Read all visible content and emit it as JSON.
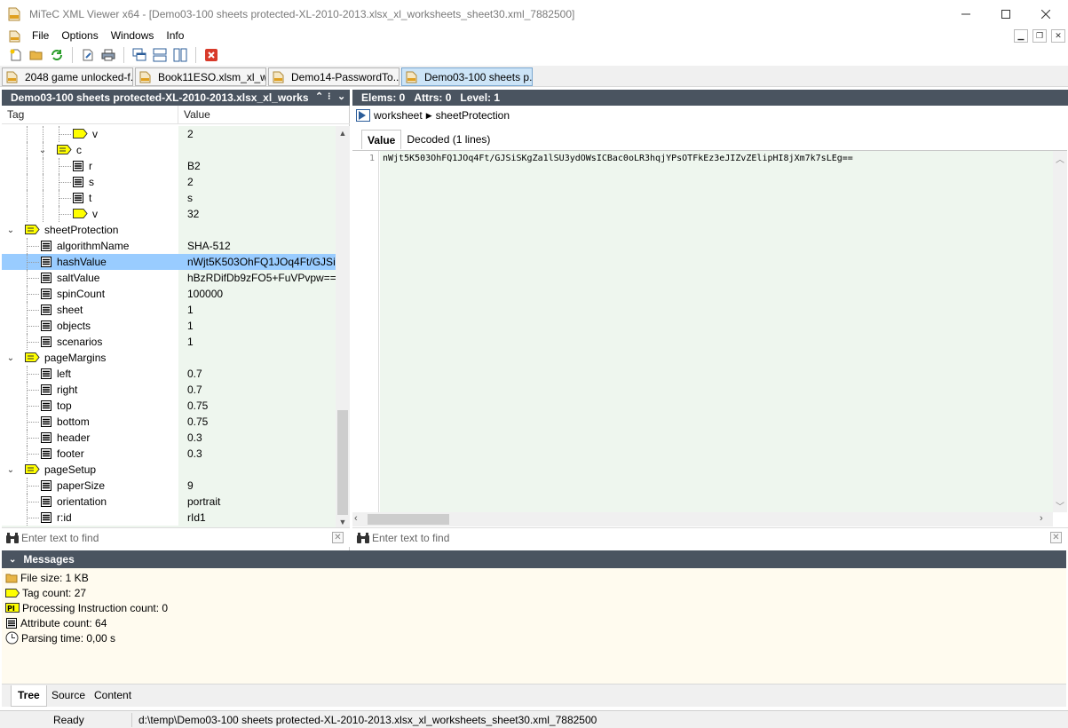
{
  "window": {
    "title": "MiTeC XML Viewer x64 - [Demo03-100 sheets protected-XL-2010-2013.xlsx_xl_worksheets_sheet30.xml_7882500]"
  },
  "menu": [
    "File",
    "Options",
    "Windows",
    "Info"
  ],
  "doc_tabs": [
    {
      "label": "2048 game unlocked-f...",
      "active": false
    },
    {
      "label": "Book11ESO.xlsm_xl_w...",
      "active": false
    },
    {
      "label": "Demo14-PasswordTo...",
      "active": false
    },
    {
      "label": "Demo03-100 sheets p...",
      "active": true
    }
  ],
  "left_panel": {
    "title": "Demo03-100 sheets protected-XL-2010-2013.xlsx_xl_works",
    "col_tag": "Tag",
    "col_value": "Value",
    "find_placeholder": "Enter text to find"
  },
  "tree": [
    {
      "label": "v",
      "value": "2",
      "kind": "element",
      "level": 4,
      "expander": ""
    },
    {
      "label": "c",
      "value": "",
      "kind": "element",
      "level": 3,
      "expander": "open"
    },
    {
      "label": "r",
      "value": "B2",
      "kind": "attr",
      "level": 4,
      "expander": ""
    },
    {
      "label": "s",
      "value": "2",
      "kind": "attr",
      "level": 4,
      "expander": ""
    },
    {
      "label": "t",
      "value": "s",
      "kind": "attr",
      "level": 4,
      "expander": ""
    },
    {
      "label": "v",
      "value": "32",
      "kind": "element",
      "level": 4,
      "expander": ""
    },
    {
      "label": "sheetProtection",
      "value": "",
      "kind": "element",
      "level": 1,
      "expander": "open"
    },
    {
      "label": "algorithmName",
      "value": "SHA-512",
      "kind": "attr",
      "level": 2,
      "expander": ""
    },
    {
      "label": "hashValue",
      "value": "nWjt5K503OhFQ1JOq4Ft/GJSi...",
      "kind": "attr",
      "level": 2,
      "expander": "",
      "selected": true
    },
    {
      "label": "saltValue",
      "value": "hBzRDifDb9zFO5+FuVPvpw==",
      "kind": "attr",
      "level": 2,
      "expander": ""
    },
    {
      "label": "spinCount",
      "value": "100000",
      "kind": "attr",
      "level": 2,
      "expander": ""
    },
    {
      "label": "sheet",
      "value": "1",
      "kind": "attr",
      "level": 2,
      "expander": ""
    },
    {
      "label": "objects",
      "value": "1",
      "kind": "attr",
      "level": 2,
      "expander": ""
    },
    {
      "label": "scenarios",
      "value": "1",
      "kind": "attr",
      "level": 2,
      "expander": ""
    },
    {
      "label": "pageMargins",
      "value": "",
      "kind": "element",
      "level": 1,
      "expander": "open"
    },
    {
      "label": "left",
      "value": "0.7",
      "kind": "attr",
      "level": 2,
      "expander": ""
    },
    {
      "label": "right",
      "value": "0.7",
      "kind": "attr",
      "level": 2,
      "expander": ""
    },
    {
      "label": "top",
      "value": "0.75",
      "kind": "attr",
      "level": 2,
      "expander": ""
    },
    {
      "label": "bottom",
      "value": "0.75",
      "kind": "attr",
      "level": 2,
      "expander": ""
    },
    {
      "label": "header",
      "value": "0.3",
      "kind": "attr",
      "level": 2,
      "expander": ""
    },
    {
      "label": "footer",
      "value": "0.3",
      "kind": "attr",
      "level": 2,
      "expander": ""
    },
    {
      "label": "pageSetup",
      "value": "",
      "kind": "element",
      "level": 1,
      "expander": "open"
    },
    {
      "label": "paperSize",
      "value": "9",
      "kind": "attr",
      "level": 2,
      "expander": ""
    },
    {
      "label": "orientation",
      "value": "portrait",
      "kind": "attr",
      "level": 2,
      "expander": ""
    },
    {
      "label": "r:id",
      "value": "rId1",
      "kind": "attr",
      "level": 2,
      "expander": ""
    }
  ],
  "right_panel": {
    "elems": "Elems: 0",
    "attrs": "Attrs: 0",
    "level": "Level: 1",
    "breadcrumb": [
      "worksheet",
      "sheetProtection"
    ],
    "tab_value": "Value",
    "tab_decoded": "Decoded (1 lines)",
    "line_number": "1",
    "code": "nWjt5K503OhFQ1JOq4Ft/GJSiSKgZa1lSU3ydOWsICBac0oLR3hqjYPsOTFkEz3eJIZvZElipHI8jXm7k7sLEg==",
    "find_placeholder": "Enter text to find"
  },
  "messages": {
    "title": "Messages",
    "items": [
      {
        "icon": "folder-icon",
        "text": "File size: 1 KB"
      },
      {
        "icon": "tag-icon",
        "text": "Tag count: 27"
      },
      {
        "icon": "pi-icon",
        "text": "Processing Instruction count: 0"
      },
      {
        "icon": "attribute-icon",
        "text": "Attribute count: 64"
      },
      {
        "icon": "clock-icon",
        "text": "Parsing time: 0,00 s"
      }
    ]
  },
  "bottom_tabs": [
    {
      "label": "Tree",
      "active": true
    },
    {
      "label": "Source",
      "active": false
    },
    {
      "label": "Content",
      "active": false
    }
  ],
  "status": {
    "ready": "Ready",
    "path": "d:\\temp\\Demo03-100 sheets protected-XL-2010-2013.xlsx_xl_worksheets_sheet30.xml_7882500"
  },
  "colors": {
    "panel_header": "#4a5460",
    "selection": "#99ccff",
    "tree_bg": "#eef6ee",
    "tag_yellow": "#ffff00",
    "messages_bg": "#fffbef"
  }
}
